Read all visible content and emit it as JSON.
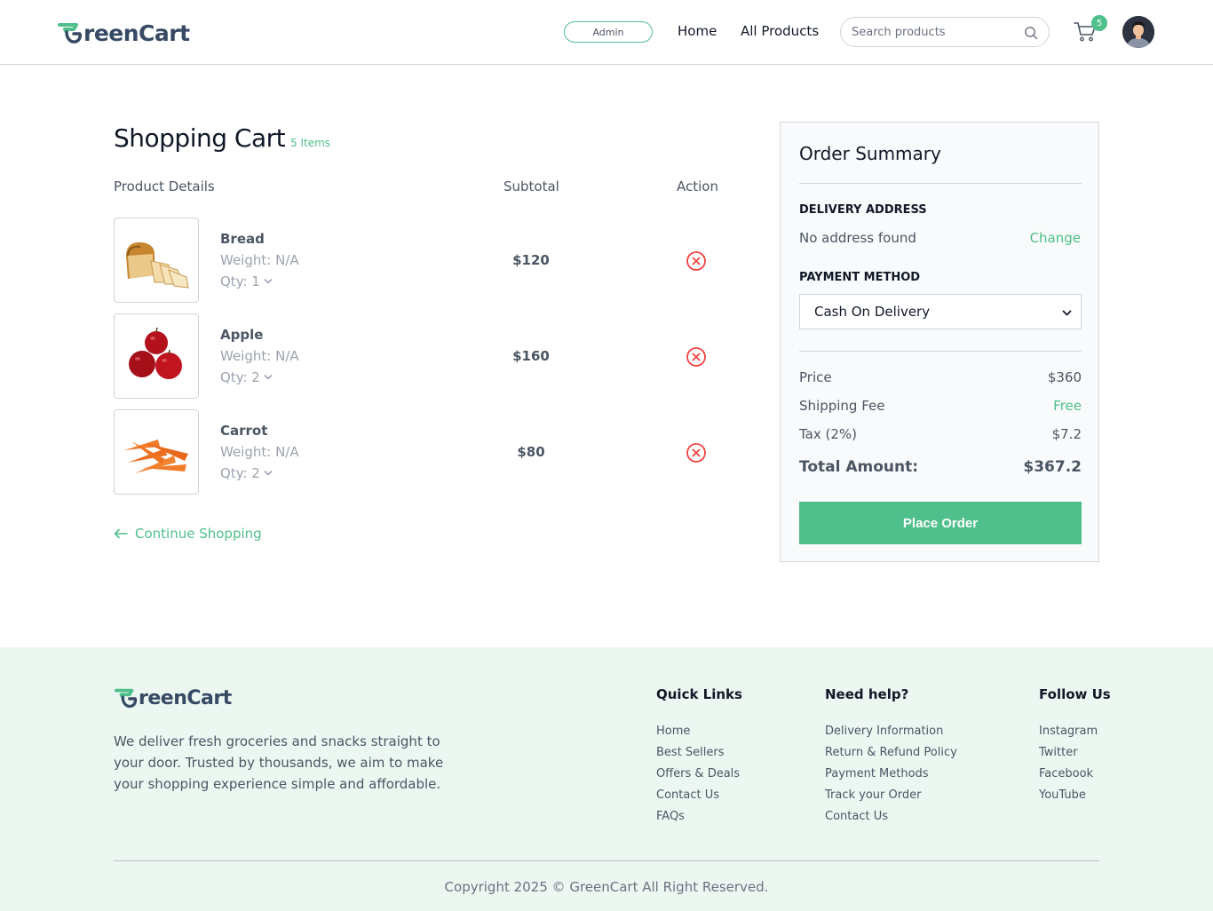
{
  "brand": {
    "name": "GreenCart",
    "logo_rest": "reenCart",
    "accent": "#4fbf8b",
    "text_color": "#364a63"
  },
  "header": {
    "admin_label": "Admin",
    "nav": [
      {
        "label": "Home"
      },
      {
        "label": "All Products"
      }
    ],
    "search_placeholder": "Search products",
    "cart_count": "5"
  },
  "cart": {
    "title": "Shopping Cart",
    "count_label": "5 Items",
    "columns": {
      "product": "Product Details",
      "subtotal": "Subtotal",
      "action": "Action"
    },
    "items": [
      {
        "name": "Bread",
        "weight": "Weight: N/A",
        "qty": "Qty: 1",
        "subtotal": "$120",
        "image": "bread-image"
      },
      {
        "name": "Apple",
        "weight": "Weight: N/A",
        "qty": "Qty: 2",
        "subtotal": "$160",
        "image": "apple-image"
      },
      {
        "name": "Carrot",
        "weight": "Weight: N/A",
        "qty": "Qty: 2",
        "subtotal": "$80",
        "image": "carrot-image"
      }
    ],
    "continue_label": "Continue Shopping"
  },
  "summary": {
    "title": "Order Summary",
    "delivery_label": "DELIVERY ADDRESS",
    "address": "No address found",
    "change_label": "Change",
    "payment_label": "PAYMENT METHOD",
    "payment_value": "Cash On Delivery",
    "price_label": "Price",
    "price_value": "$360",
    "shipping_label": "Shipping Fee",
    "shipping_value": "Free",
    "tax_label": "Tax (2%)",
    "tax_value": "$7.2",
    "total_label": "Total Amount:",
    "total_value": "$367.2",
    "place_order": "Place Order"
  },
  "footer": {
    "description": "We deliver fresh groceries and snacks straight to your door. Trusted by thousands, we aim to make your shopping experience simple and affordable.",
    "columns": [
      {
        "title": "Quick Links",
        "links": [
          "Home",
          "Best Sellers",
          "Offers & Deals",
          "Contact Us",
          "FAQs"
        ]
      },
      {
        "title": "Need help?",
        "links": [
          "Delivery Information",
          "Return & Refund Policy",
          "Payment Methods",
          "Track your Order",
          "Contact Us"
        ]
      },
      {
        "title": "Follow Us",
        "links": [
          "Instagram",
          "Twitter",
          "Facebook",
          "YouTube"
        ]
      }
    ],
    "copyright": "Copyright 2025 © GreenCart All Right Reserved."
  }
}
